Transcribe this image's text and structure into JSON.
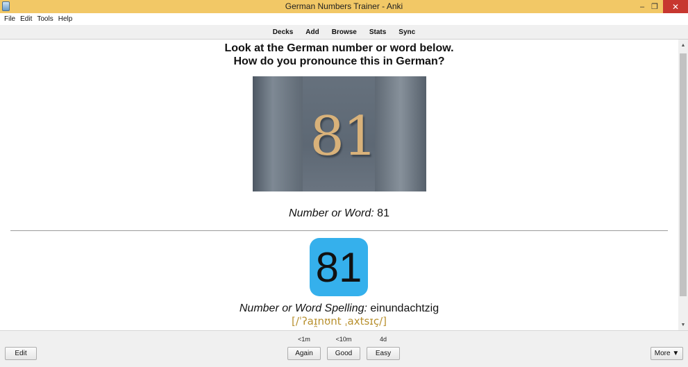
{
  "window": {
    "title": "German Numbers Trainer - Anki",
    "minimize_icon": "–",
    "restore_icon": "❐",
    "close_icon": "✕"
  },
  "menu": [
    "File",
    "Edit",
    "Tools",
    "Help"
  ],
  "toolbar": [
    "Decks",
    "Add",
    "Browse",
    "Stats",
    "Sync"
  ],
  "card": {
    "question_line1": "Look at the German number or word below.",
    "question_line2": "How do you pronounce this in German?",
    "image_number": "81",
    "number_label": "Number or Word:",
    "number_value": "81",
    "badge_number": "81",
    "spelling_label": "Number or Word Spelling:",
    "spelling_value": "einundachtzig",
    "ipa": "[/ˈʔaɪ̯nʊnt ˌaxtsɪç/]"
  },
  "bottom": {
    "edit_label": "Edit",
    "more_label": "More ▼",
    "again_time": "<1m",
    "good_time": "<10m",
    "easy_time": "4d",
    "again_label": "Again",
    "good_label": "Good",
    "easy_label": "Easy"
  },
  "colors": {
    "titlebar": "#f2c866",
    "badge": "#35b0ec",
    "ipa": "#b8902e",
    "close": "#c7372f"
  }
}
